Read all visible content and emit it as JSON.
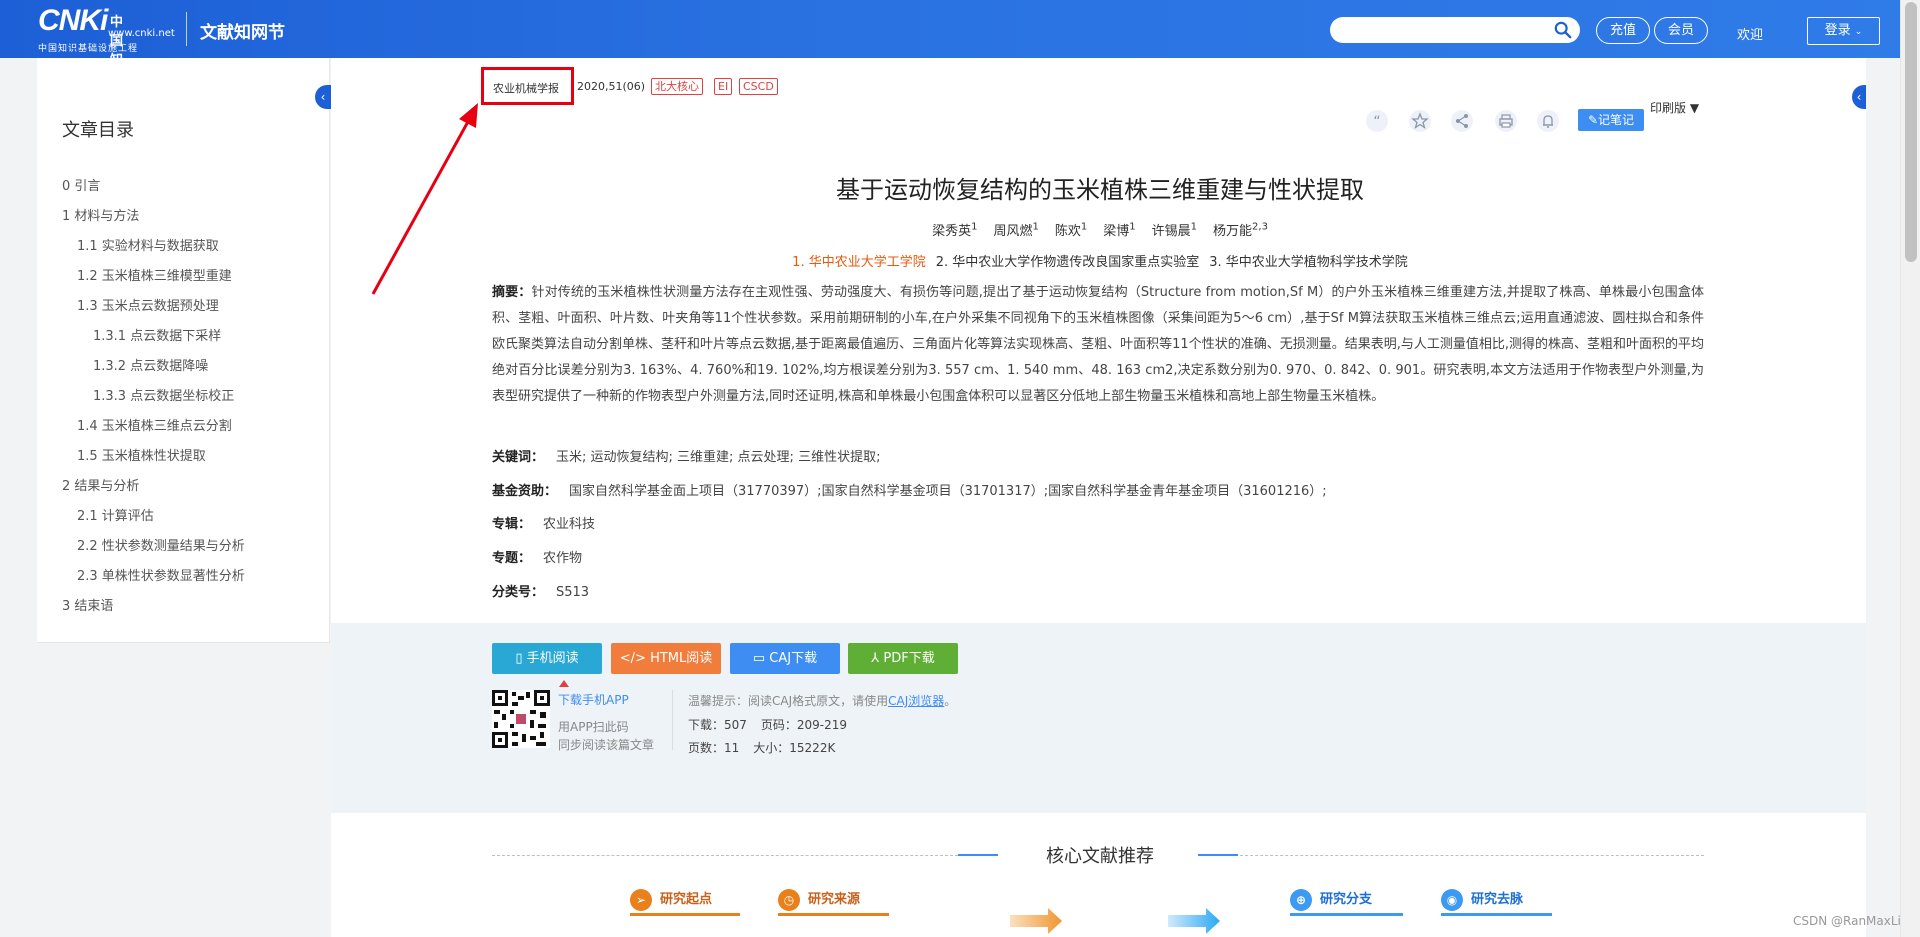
{
  "header": {
    "logo_text": "CNKi",
    "logo_cn": "中国知网",
    "logo_url": "www.cnki.net",
    "logo_sub": "中国知识基础设施工程",
    "site_title": "文献知网节",
    "search_placeholder": "",
    "recharge": "充值",
    "vip": "会员",
    "welcome": "欢迎",
    "login": "登录"
  },
  "toc": {
    "title": "文章目录",
    "items": [
      {
        "label": "0 引言",
        "level": 1
      },
      {
        "label": "1 材料与方法",
        "level": 1
      },
      {
        "label": "1.1 实验材料与数据获取",
        "level": 2
      },
      {
        "label": "1.2 玉米植株三维模型重建",
        "level": 2
      },
      {
        "label": "1.3 玉米点云数据预处理",
        "level": 2
      },
      {
        "label": "1.3.1 点云数据下采样",
        "level": 3
      },
      {
        "label": "1.3.2 点云数据降噪",
        "level": 3
      },
      {
        "label": "1.3.3 点云数据坐标校正",
        "level": 3
      },
      {
        "label": "1.4 玉米植株三维点云分割",
        "level": 2
      },
      {
        "label": "1.5 玉米植株性状提取",
        "level": 2
      },
      {
        "label": "2 结果与分析",
        "level": 1
      },
      {
        "label": "2.1 计算评估",
        "level": 2
      },
      {
        "label": "2.2 性状参数测量结果与分析",
        "level": 2
      },
      {
        "label": "2.3 单株性状参数显著性分析",
        "level": 2
      },
      {
        "label": "3 结束语",
        "level": 1
      }
    ]
  },
  "article": {
    "journal": "农业机械学报",
    "issue": ". 2020,51(06)",
    "badges": [
      "北大核心",
      "EI",
      "CSCD"
    ],
    "print_version": "印刷版",
    "note_button": "记笔记",
    "title": "基于运动恢复结构的玉米植株三维重建与性状提取",
    "authors": [
      {
        "name": "梁秀英",
        "sup": "1"
      },
      {
        "name": "周风燃",
        "sup": "1"
      },
      {
        "name": "陈欢",
        "sup": "1"
      },
      {
        "name": "梁博",
        "sup": "1"
      },
      {
        "name": "许锡晨",
        "sup": "1"
      },
      {
        "name": "杨万能",
        "sup": "2,3"
      }
    ],
    "affiliations": [
      "1. 华中农业大学工学院",
      "2. 华中农业大学作物遗传改良国家重点实验室",
      "3. 华中农业大学植物科学技术学院"
    ],
    "abstract_label": "摘要：",
    "abstract": "针对传统的玉米植株性状测量方法存在主观性强、劳动强度大、有损伤等问题,提出了基于运动恢复结构（Structure from motion,Sf M）的户外玉米植株三维重建方法,并提取了株高、单株最小包围盒体积、茎粗、叶面积、叶片数、叶夹角等11个性状参数。采用前期研制的小车,在户外采集不同视角下的玉米植株图像（采集间距为5～6 cm）,基于Sf M算法获取玉米植株三维点云;运用直通滤波、圆柱拟合和条件欧氏聚类算法自动分割单株、茎秆和叶片等点云数据,基于距离最值遍历、三角面片化等算法实现株高、茎粗、叶面积等11个性状的准确、无损测量。结果表明,与人工测量值相比,测得的株高、茎粗和叶面积的平均绝对百分比误差分别为3. 163%、4. 760%和19. 102%,均方根误差分别为3. 557 cm、1. 540 mm、48. 163 cm2,决定系数分别为0. 970、0. 842、0. 901。研究表明,本文方法适用于作物表型户外测量,为表型研究提供了一种新的作物表型户外测量方法,同时还证明,株高和单株最小包围盒体积可以显著区分低地上部生物量玉米植株和高地上部生物量玉米植株。",
    "keywords_label": "关键词：",
    "keywords": "玉米;  运动恢复结构;  三维重建;  点云处理;  三维性状提取;",
    "funding_label": "基金资助：",
    "funding": "国家自然科学基金面上项目（31770397）;国家自然科学基金项目（31701317）;国家自然科学基金青年基金项目（31601216）;",
    "series_label": "专辑：",
    "series": "农业科技",
    "topic_label": "专题：",
    "topic": "农作物",
    "class_label": "分类号：",
    "class": "S513"
  },
  "download": {
    "mobile": "手机阅读",
    "html": "HTML阅读",
    "caj": "CAJ下载",
    "pdf": "PDF下载",
    "app_link": "下载手机APP",
    "app_scan": "用APP扫此码",
    "app_sync": "同步阅读该篇文章",
    "tip_prefix": "温馨提示：阅读CAJ格式原文，请使用",
    "tip_link": "CAJ浏览器",
    "tip_suffix": "。",
    "downloads": "下载：507",
    "pages_range": "页码：209-219",
    "page_count": "页数：11",
    "size": "大小：15222K"
  },
  "recommend": {
    "title": "核心文献推荐",
    "tabs": [
      "研究起点",
      "研究来源",
      "研究分支",
      "研究去脉"
    ]
  },
  "watermark": "CSDN @RanMaxLi",
  "colors": {
    "header_blue": "#1d5fd6",
    "annotation_red": "#e60012",
    "affil_orange": "#e8590c"
  }
}
